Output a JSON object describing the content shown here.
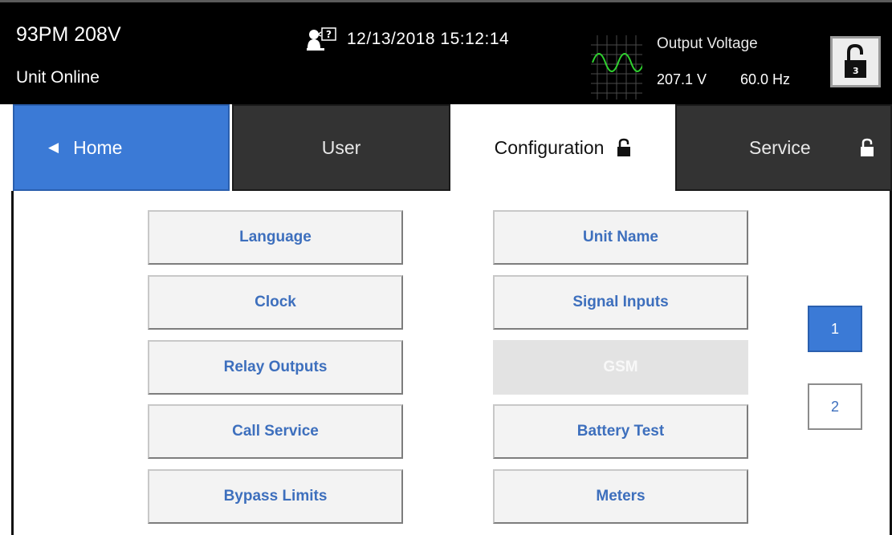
{
  "status": {
    "unit_name": "93PM 208V",
    "unit_status": "Unit Online",
    "datetime": "12/13/2018 15:12:14",
    "output_title": "Output Voltage",
    "voltage": "207.1 V",
    "frequency": "60.0 Hz",
    "lock_level": "3"
  },
  "tabs": {
    "home": "Home",
    "user": "User",
    "configuration": "Configuration",
    "service": "Service"
  },
  "menu_left": [
    "Language",
    "Clock",
    "Relay Outputs",
    "Call Service",
    "Bypass Limits"
  ],
  "menu_right": [
    "Unit Name",
    "Signal Inputs",
    "GSM",
    "Battery Test",
    "Meters"
  ],
  "pager": [
    "1",
    "2"
  ],
  "icons": {
    "home_arrow": "left-triangle-icon",
    "lock": "unlocked-padlock-icon",
    "notice": "user-notice-icon",
    "scope": "sine-wave-icon"
  },
  "colors": {
    "accent_blue": "#3b7ad6",
    "button_text": "#3d6fbd",
    "tab_dark": "#333333",
    "disabled": "#e3e3e3"
  }
}
